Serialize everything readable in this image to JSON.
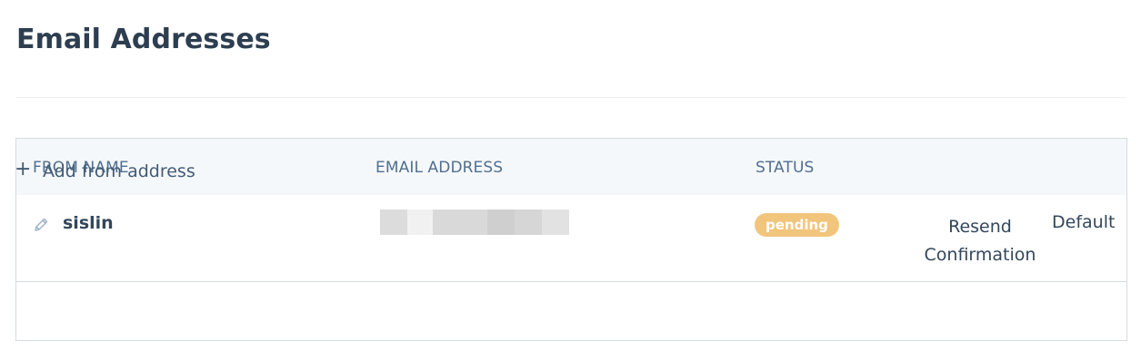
{
  "page": {
    "title": "Email Addresses"
  },
  "table": {
    "headers": {
      "from_name": "FROM NAME",
      "email_address": "EMAIL ADDRESS",
      "status": "STATUS"
    },
    "rows": [
      {
        "from_name": "sislin",
        "email_address_redacted": true,
        "status": "pending",
        "actions": {
          "resend": "Resend Confirmation",
          "default": "Default"
        }
      }
    ],
    "add_label": "Add from address"
  },
  "icons": {
    "edit": "pencil-icon",
    "add": "plus-icon"
  },
  "colors": {
    "status_pending": "#f2c57c",
    "header_bg": "#f5f8fa",
    "border": "#d4dbe2",
    "text": "#33475b",
    "link": "#425b76"
  }
}
